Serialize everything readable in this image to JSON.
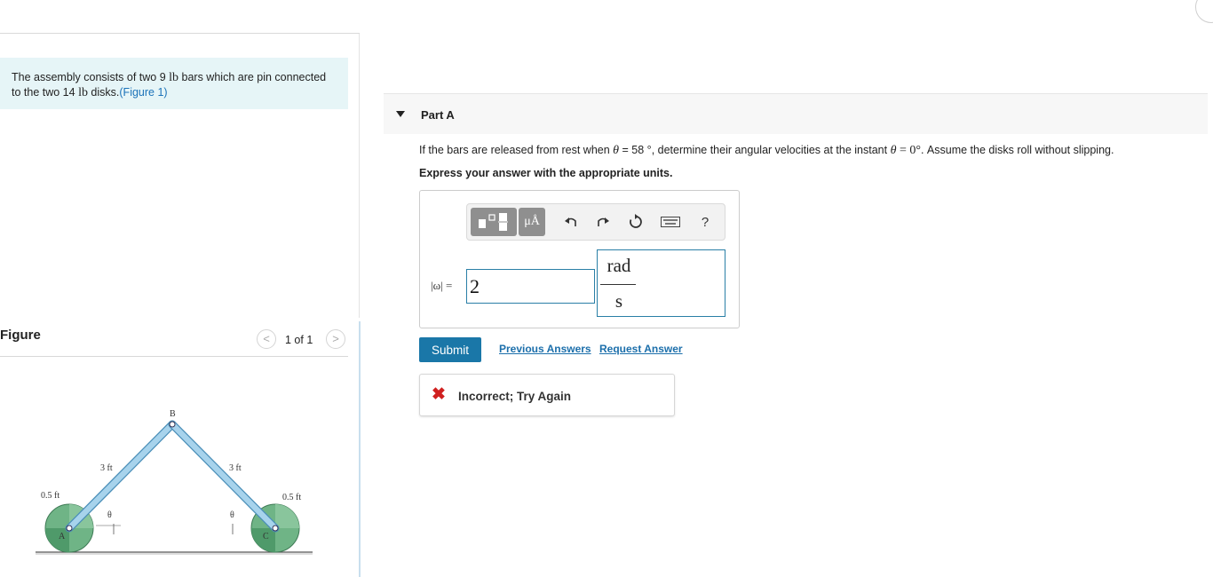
{
  "intro": {
    "text_before": "The assembly consists of two 9 ",
    "unit1": "lb",
    "text_middle": " bars which are pin connected to the two 14 ",
    "unit2": "lb",
    "text_after": " disks.",
    "figure_link": "(Figure 1)"
  },
  "figure_panel": {
    "title": "Figure",
    "prev_icon": "<",
    "next_icon": ">",
    "pager": "1 of 1",
    "diagram": {
      "labels": {
        "B": "B",
        "A": "A",
        "C": "C",
        "left_bar": "3 ft",
        "right_bar": "3 ft",
        "left_radius": "0.5 ft",
        "right_radius": "0.5 ft",
        "theta_left": "θ",
        "theta_right": "θ"
      },
      "colors": {
        "disk": "#6fb486",
        "disk_shade": "#3e8e5c",
        "bar_fill": "#a7d3ec",
        "bar_edge": "#4b8fb8"
      }
    }
  },
  "part": {
    "caret_icon": "caret-down-icon",
    "title": "Part A",
    "question_start": "If the bars are released from rest when ",
    "theta": "θ",
    "equals_58": " = 58 °",
    "question_mid": ", determine their angular velocities at the instant ",
    "equals_0": " = 0°",
    "question_end": ". Assume the disks roll without slipping.",
    "express": "Express your answer with the appropriate units."
  },
  "toolbar": {
    "icons": [
      "fraction-template-icon",
      "units-icon",
      "undo-icon",
      "redo-icon",
      "reset-icon",
      "keyboard-icon",
      "help-icon"
    ],
    "units_label": "μÅ",
    "help_label": "?"
  },
  "answer": {
    "label": "|ω| =",
    "value": "2",
    "unit_numerator": "rad",
    "unit_denominator": "s"
  },
  "actions": {
    "submit": "Submit",
    "previous_answers": "Previous Answers",
    "request_answer": "Request Answer"
  },
  "feedback": {
    "icon": "✖",
    "text": "Incorrect; Try Again",
    "color": "#d0201f"
  },
  "colors": {
    "accent": "#1a77a8",
    "link": "#1c6fab",
    "intro_bg": "#e6f5f7"
  }
}
